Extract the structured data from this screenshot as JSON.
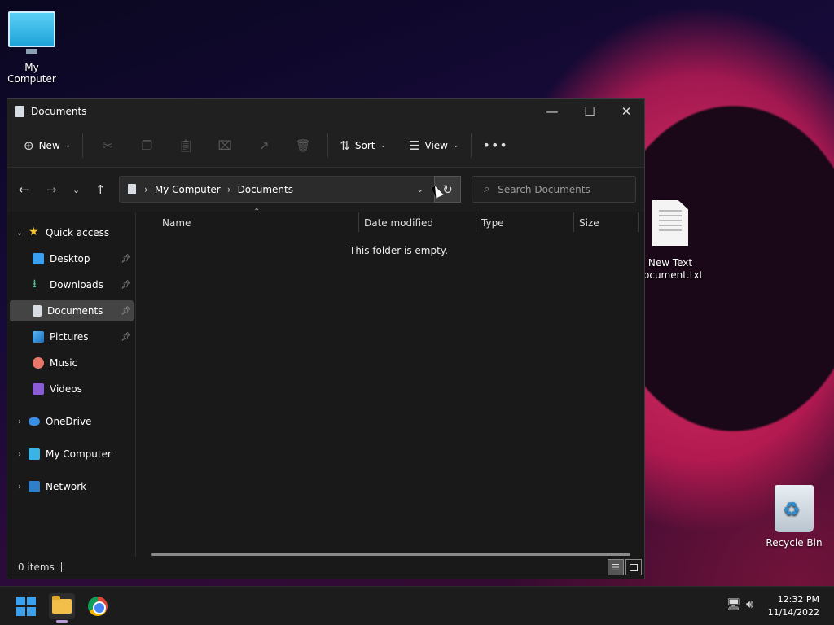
{
  "desktop": {
    "icons": [
      {
        "label": "My Computer"
      },
      {
        "label": "New Text Document.txt",
        "line1": "New Text",
        "line2": "ocument.txt"
      },
      {
        "label": "Recycle Bin"
      }
    ]
  },
  "window": {
    "title": "Documents",
    "toolbar": {
      "new_label": "New",
      "sort_label": "Sort",
      "view_label": "View"
    },
    "address": {
      "segments": [
        "My Computer",
        "Documents"
      ]
    },
    "search": {
      "placeholder": "Search Documents"
    },
    "sidebar": {
      "quick_access": "Quick access",
      "items": [
        {
          "label": "Desktop",
          "icon": "desktop-icon",
          "pinned": true
        },
        {
          "label": "Downloads",
          "icon": "download-icon",
          "pinned": true
        },
        {
          "label": "Documents",
          "icon": "document-icon",
          "pinned": true,
          "selected": true
        },
        {
          "label": "Pictures",
          "icon": "pictures-icon",
          "pinned": true
        },
        {
          "label": "Music",
          "icon": "music-icon",
          "pinned": false
        },
        {
          "label": "Videos",
          "icon": "videos-icon",
          "pinned": false
        }
      ],
      "roots": [
        {
          "label": "OneDrive",
          "icon": "cloud-icon"
        },
        {
          "label": "My Computer",
          "icon": "computer-icon"
        },
        {
          "label": "Network",
          "icon": "network-icon"
        }
      ]
    },
    "columns": [
      "Name",
      "Date modified",
      "Type",
      "Size"
    ],
    "empty_message": "This folder is empty.",
    "status": {
      "items_count": "0 items"
    }
  },
  "taskbar": {
    "time": "12:32 PM",
    "date": "11/14/2022"
  },
  "colors": {
    "accent": "#3aa0f0",
    "window_bg": "#191919",
    "selected_bg": "#444444"
  }
}
